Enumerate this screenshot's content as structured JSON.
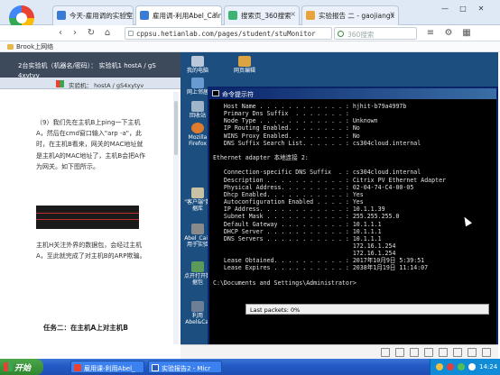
{
  "browser": {
    "tabs": [
      {
        "label": "今天-雇用调的实验室",
        "color": "#3a7bd5"
      },
      {
        "label": "雇用调-利用Abel_Cain密",
        "color": "#3a7bd5"
      },
      {
        "label": "搜索页_360搜索",
        "color": "#3cb371"
      },
      {
        "label": "实验报告 二 - gaojiangx",
        "color": "#e8a33a"
      }
    ],
    "address": "cppsu.hetianlab.com/pages/student/stuMonitor",
    "search_placeholder": "360搜索",
    "bookmark": "Brook上网络"
  },
  "guide": {
    "header_line1": "2台实验机（机器名/密码）： 实验机1  hostA / gS",
    "header_line2": "4xytyv",
    "inner_window_title": "实验机：   hostA / gS4xytyv",
    "paragraph": "（9）我们先在主机B上ping一下主机A，然后在cmd窗口输入\"arp -a\"，此时，在主机B看来，网关的MAC地址就是主机A的MAC地址了，主机B会把A作为网关。如下图所示。",
    "paragraph2": "主机H关注外界的数据包，会经过主机A，至此就完成了对主机B的ARP欺骗。",
    "task_heading": "任务二：在主机A上对主机B"
  },
  "desktop_icons": [
    {
      "label": "我的电脑"
    },
    {
      "label": "网上邻居"
    },
    {
      "label": "网页编辑"
    },
    {
      "label": "回收站"
    },
    {
      "label": "Mozilla Firefox"
    },
    {
      "label": "\"客户端\"数据库"
    },
    {
      "label": "Abel_Cain用于实验"
    },
    {
      "label": "点开打开数据包"
    },
    {
      "label": "利用 Abel&Cai"
    }
  ],
  "cmd": {
    "title": "命令提示符",
    "lines": [
      "   Host Name . . . . . . . . . . . . : hjhit-b79a4997b",
      "   Primary Dns Suffix  . . . . . . . :",
      "   Node Type . . . . . . . . . . . . : Unknown",
      "   IP Routing Enabled. . . . . . . . : No",
      "   WINS Proxy Enabled. . . . . . . . : No",
      "   DNS Suffix Search List. . . . . . : cs304cloud.internal",
      "",
      "Ethernet adapter 本地连接 2:",
      "",
      "   Connection-specific DNS Suffix  . : cs304cloud.internal",
      "   Description . . . . . . . . . . . : Citrix PV Ethernet Adapter",
      "   Physical Address. . . . . . . . . : 02-04-74-C4-00-05",
      "   Dhcp Enabled. . . . . . . . . . . : Yes",
      "   Autoconfiguration Enabled . . . . : Yes",
      "   IP Address. . . . . . . . . . . . : 10.1.1.39",
      "   Subnet Mask . . . . . . . . . . . : 255.255.255.0",
      "   Default Gateway . . . . . . . . . : 10.1.1.1",
      "   DHCP Server . . . . . . . . . . . : 10.1.1.1",
      "   DNS Servers . . . . . . . . . . . : 10.1.1.1",
      "                                       172.16.1.254",
      "                                       172.16.1.254",
      "   Lease Obtained. . . . . . . . . . : 2017年10月9日 5:39:51",
      "   Lease Expires . . . . . . . . . . : 2038年1月19日 11:14:07",
      "",
      "C:\\Documents and Settings\\Administrator>"
    ]
  },
  "lastpackets": "Last packets:   0%",
  "taskbar": {
    "start": "开始",
    "items": [
      {
        "label": "雇用课-利用Abel_"
      },
      {
        "label": "实验报告2 - Micr"
      }
    ],
    "clock": "14:24"
  },
  "colors": {
    "desktop_bg": "#1c4f80",
    "taskbar": "#245bc6",
    "start_green": "#3a9a3a"
  }
}
